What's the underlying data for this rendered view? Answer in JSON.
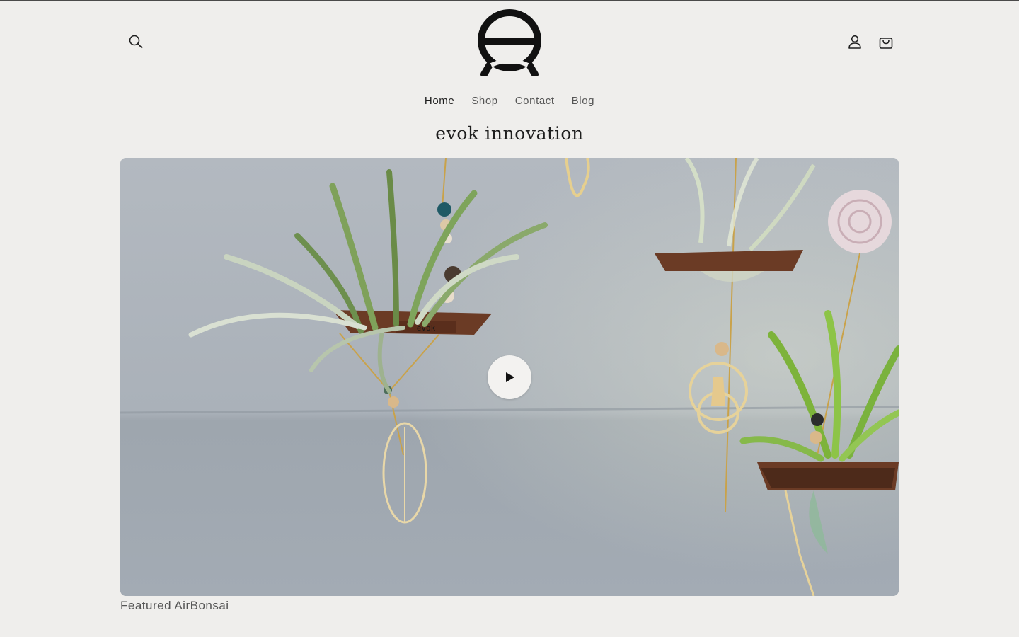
{
  "header": {
    "icons": {
      "search": "search-icon",
      "logo": "evok-logo",
      "account": "user-icon",
      "cart": "cart-icon"
    }
  },
  "nav": {
    "items": [
      {
        "label": "Home",
        "active": true
      },
      {
        "label": "Shop",
        "active": false
      },
      {
        "label": "Contact",
        "active": false
      },
      {
        "label": "Blog",
        "active": false
      }
    ]
  },
  "main": {
    "title": "evok innovation",
    "video": {
      "shelf_label": "evok",
      "play_icon": "play-icon"
    },
    "caption": "Featured AirBonsai"
  },
  "colors": {
    "background": "#efeeec",
    "text": "#1e1e1e",
    "muted": "#555555",
    "wood": "#6b3b25"
  }
}
